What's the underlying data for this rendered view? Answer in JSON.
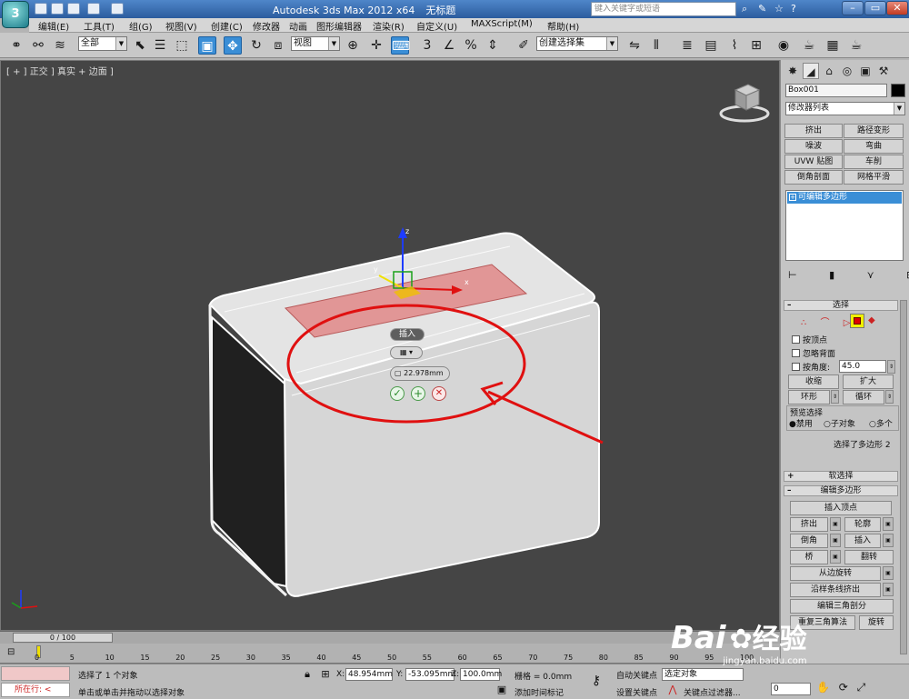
{
  "title_bar": {
    "app": "Autodesk 3ds Max  2012 x64",
    "doc": "无标题",
    "search_placeholder": "键入关键字或短语",
    "logo": "3"
  },
  "menu": [
    "编辑(E)",
    "工具(T)",
    "组(G)",
    "视图(V)",
    "创建(C)",
    "修改器",
    "动画",
    "图形编辑器",
    "渲染(R)",
    "自定义(U)",
    "MAXScript(M)",
    "帮助(H)"
  ],
  "toolbar": {
    "filter": "全部",
    "ref_coord": "视图",
    "snap_labels": [
      "3",
      "%"
    ],
    "named_sel": "创建选择集"
  },
  "viewport": {
    "label": "[ + ] 正交 ] 真实 + 边面 ]",
    "caddy": {
      "title": "插入",
      "amount": "22.978mm"
    },
    "axis_labels": {
      "z": "z",
      "y": "y",
      "x": "x"
    }
  },
  "panel": {
    "object_name": "Box001",
    "modifier_list": "修改器列表",
    "mod_buttons": [
      [
        "挤出",
        "路径变形"
      ],
      [
        "噪波",
        "弯曲"
      ],
      [
        "UVW 贴图",
        "车削"
      ],
      [
        "倒角剖面",
        "网格平滑"
      ]
    ],
    "stack_item": "可编辑多边形",
    "selection": {
      "header": "选择",
      "by_vertex": "按顶点",
      "ignore_backface": "忽略背面",
      "by_angle": "按角度:",
      "angle_value": "45.0",
      "shrink": "收缩",
      "grow": "扩大",
      "ring": "环形",
      "loop": "循环",
      "preview_label": "预览选择",
      "preview_opts": [
        "禁用",
        "子对象",
        "多个"
      ],
      "info": "选择了多边形 2"
    },
    "soft_selection": "软选择",
    "edit_poly": {
      "header": "编辑多边形",
      "insert_vertex": "插入顶点",
      "extrude": "挤出",
      "outline": "轮廓",
      "bevel": "倒角",
      "inset": "插入",
      "bridge": "桥",
      "flip": "翻转",
      "hinge": "从边旋转",
      "extrude_spline": "沿样条线挤出",
      "edit_tri": "编辑三角剖分",
      "retri": "重复三角算法",
      "turn": "旋转"
    }
  },
  "timeline": {
    "frame": "0 / 100",
    "ticks": [
      "0",
      "5",
      "10",
      "15",
      "20",
      "25",
      "30",
      "35",
      "40",
      "45",
      "50",
      "55",
      "60",
      "65",
      "70",
      "75",
      "80",
      "85",
      "90",
      "95",
      "100"
    ]
  },
  "status": {
    "running": "所在行:",
    "selected": "选择了 1 个对象",
    "prompt": "单击或单击并拖动以选择对象",
    "x_label": "X:",
    "x_val": "48.954mm",
    "y_label": "Y:",
    "y_val": "-53.095mm",
    "z_label": "Z:",
    "z_val": "100.0mm",
    "grid": "栅格 = 0.0mm",
    "add_tag": "添加时间标记",
    "auto_key": "自动关键点",
    "set_key": "设置关键点",
    "sel_set": "选定对象",
    "key_filter": "关键点过滤器...",
    "frame_val": "0"
  },
  "watermark": {
    "brand": "Bai",
    "brand2": "经验",
    "url": "jingyan.baidu.com"
  },
  "colors": {
    "accent": "#3a8ed6",
    "annotation": "#e01010",
    "selected_face": "#e08888",
    "viewport": "#454545"
  }
}
